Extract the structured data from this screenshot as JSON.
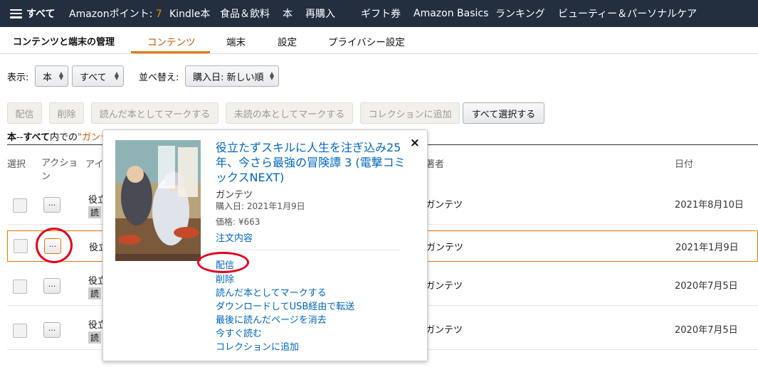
{
  "topnav": {
    "menu_label": "すべて",
    "items": [
      "Amazonポイント:",
      "7",
      "Kindle本",
      "食品＆飲料",
      "本",
      "再購入",
      "ギフト券",
      "Amazon Basics",
      "ランキング",
      "ビューティー＆パーソナルケア"
    ]
  },
  "subnav": {
    "title": "コンテンツと端末の管理",
    "tabs": [
      "コンテンツ",
      "端末",
      "設定",
      "プライバシー設定"
    ]
  },
  "filters": {
    "show_label": "表示:",
    "type_value": "本",
    "scope_value": "すべて",
    "sort_label": "並べ替え:",
    "sort_value": "購入日: 新しい順"
  },
  "actions": [
    "配信",
    "削除",
    "読んだ本としてマークする",
    "未読の本としてマークする",
    "コレクションに追加",
    "すべて選択する"
  ],
  "breadcrumb": {
    "a": "本",
    "sep": "--",
    "b": "すべて",
    "c": "内での",
    "d": "\"ガンテ"
  },
  "columns": {
    "select": "選択",
    "action": "アクション",
    "item": "アイ",
    "author": "著者",
    "date": "日付"
  },
  "rows": [
    {
      "title": "役立",
      "badge": "読",
      "author": "ガンテツ",
      "date": "2021年8月10日"
    },
    {
      "title": "役立",
      "badge": "",
      "author": "ガンテツ",
      "date": "2021年1月9日"
    },
    {
      "title": "役立",
      "badge": "読",
      "author": "ガンテツ",
      "date": "2020年7月5日"
    },
    {
      "title": "役立",
      "badge": "読",
      "author": "ガンテツ",
      "date": "2020年7月5日"
    }
  ],
  "dots_label": "...",
  "popover": {
    "close": "×",
    "title": "役立たずスキルに人生を注ぎ込み25年、今さら最強の冒険譚 3 (電撃コミックスNEXT)",
    "author": "ガンテツ",
    "purchase_date": "購入日: 2021年1月9日",
    "price": "価格: ¥663",
    "order_link": "注文内容",
    "actions": [
      "配信",
      "削除",
      "読んだ本としてマークする",
      "ダウンロードしてUSB経由で転送",
      "最後に読んだページを消去",
      "今すぐ読む",
      "コレクションに追加"
    ]
  },
  "colors": {
    "nav_bg": "#232f3e",
    "accent": "#e77600",
    "link": "#0066c0",
    "annotation": "#e3001b"
  }
}
